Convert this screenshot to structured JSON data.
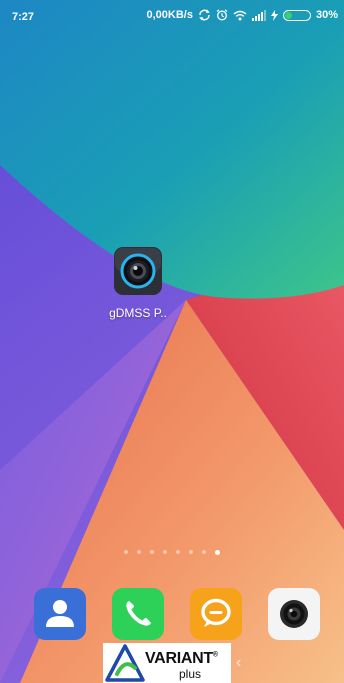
{
  "status_bar": {
    "time": "7:27",
    "net_speed": "0,00KB/s",
    "battery_text": "30%",
    "battery_level": 0.3
  },
  "icons": {
    "sync": "sync-icon",
    "alarm": "alarm-icon",
    "wifi": "wifi-icon",
    "signal": "signal-icon",
    "charging": "charging-icon",
    "battery": "battery-icon"
  },
  "home": {
    "apps": [
      {
        "label": "gDMSS P..",
        "icon": "camera-lens-icon"
      }
    ],
    "page_count": 8,
    "active_page": 8
  },
  "dock": [
    {
      "name": "contacts",
      "icon": "contacts-icon",
      "color": "#3a6fd8"
    },
    {
      "name": "phone",
      "icon": "phone-icon",
      "color": "#2ed157"
    },
    {
      "name": "messaging",
      "icon": "message-icon",
      "color": "#f7a21b"
    },
    {
      "name": "camera",
      "icon": "camera-icon",
      "color": "#f4f4f4"
    }
  ],
  "watermark": {
    "brand": "VARIANT",
    "registered": "®",
    "sub": "plus"
  },
  "nav": {
    "back_glyph": "‹"
  },
  "colors": {
    "teal": "#1b9cb7",
    "violet": "#6b5fe0",
    "red": "#e0464a",
    "orange": "#f39a6b"
  }
}
